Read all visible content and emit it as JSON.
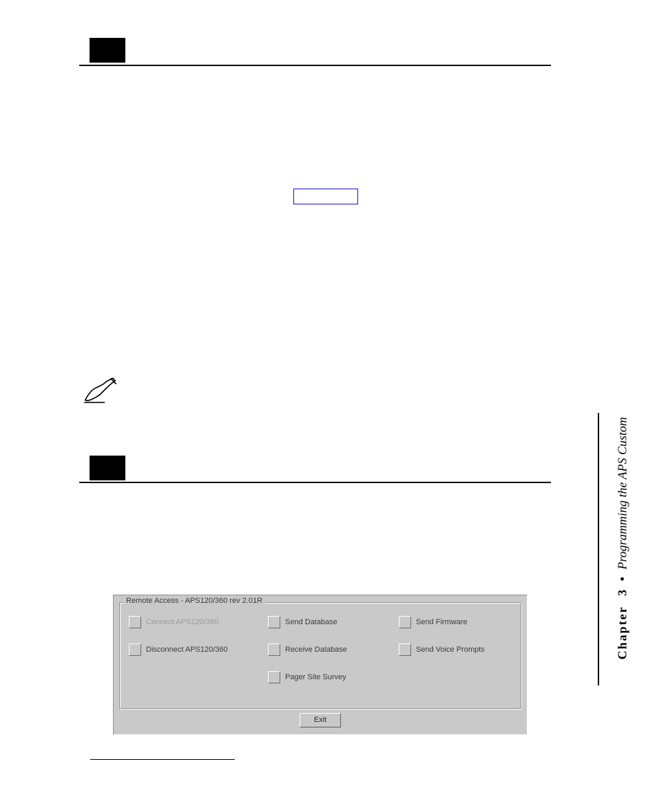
{
  "dialog": {
    "group_label": "Remote Access - APS120/360 rev 2.01R",
    "options": {
      "connect": "Connect APS120/360",
      "disconnect": "Disconnect APS120/360",
      "send_db": "Send Database",
      "recv_db": "Receive Database",
      "pager_survey": "Pager Site Survey",
      "send_fw": "Send Firmware",
      "send_voice": "Send Voice Prompts"
    },
    "exit": "Exit"
  },
  "side": {
    "chapter_word": "Chapter",
    "chapter_num": "3",
    "bullet": "•",
    "title": "Programming the APS Custom"
  }
}
